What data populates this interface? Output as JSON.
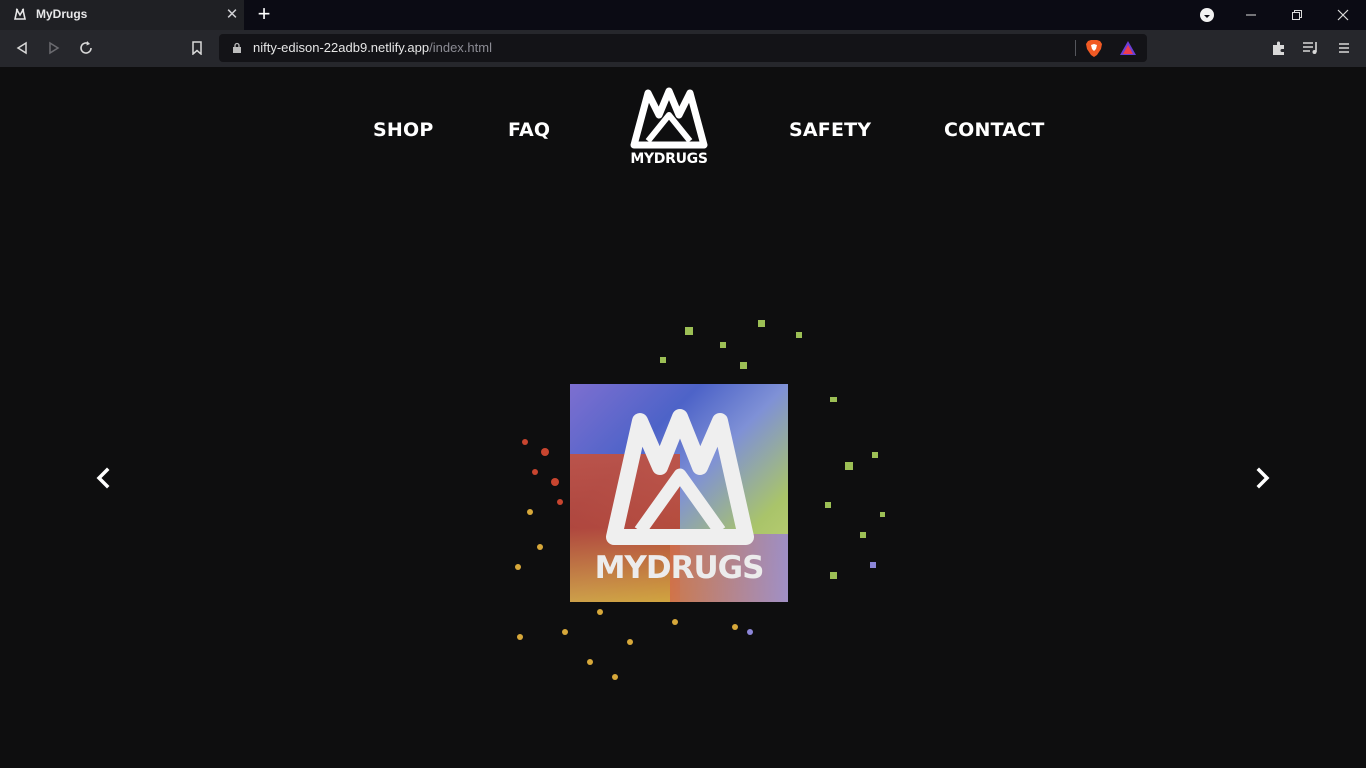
{
  "browser": {
    "tab_title": "MyDrugs",
    "url_host": "nifty-edison-22adb9.netlify.app",
    "url_path": "/index.html"
  },
  "site": {
    "nav": [
      "SHOP",
      "FAQ",
      "SAFETY",
      "CONTACT"
    ],
    "logo_text": "MYDRUGS",
    "hero_text": "MYDRUGS",
    "accent": "#ffffff",
    "background": "#0e0e0f"
  },
  "icons": {
    "prev": "chevron-left-icon",
    "next": "chevron-right-icon"
  }
}
